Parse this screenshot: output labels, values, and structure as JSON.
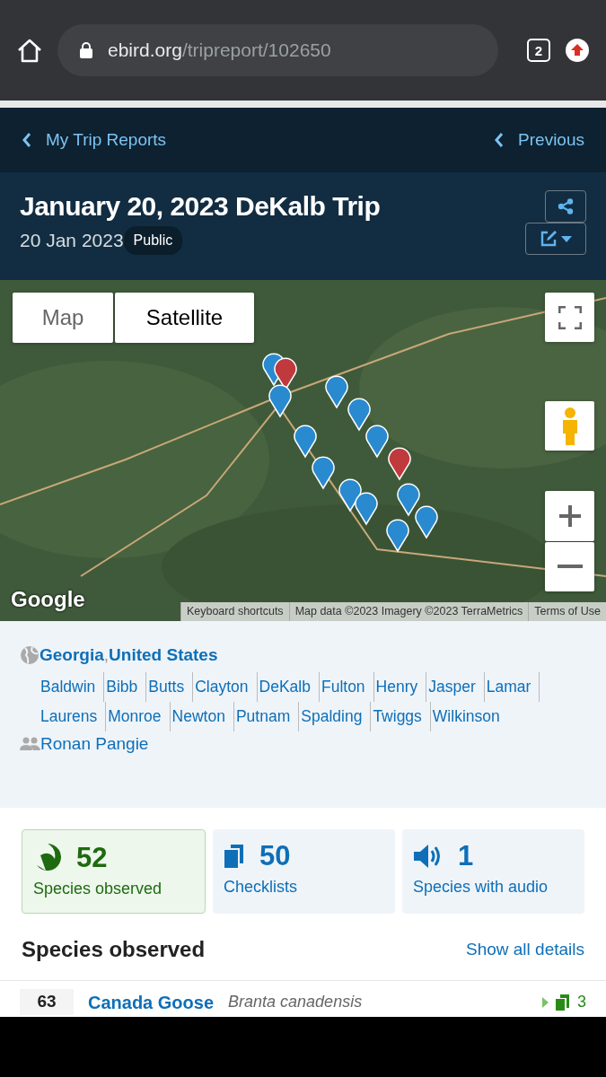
{
  "browser": {
    "url_host": "ebird.org",
    "url_path": "/tripreport/102650",
    "tab_count": "2"
  },
  "nav": {
    "back": "My Trip Reports",
    "previous": "Previous"
  },
  "header": {
    "title": "January 20, 2023 DeKalb Trip",
    "date": "20 Jan 2023",
    "visibility": "Public"
  },
  "map": {
    "type_buttons": [
      {
        "label": "Map",
        "selected": false
      },
      {
        "label": "Satellite",
        "selected": true
      }
    ],
    "logo": "Google",
    "attribution": [
      "Keyboard shortcuts",
      "Map data ©2023 Imagery ©2023 TerraMetrics",
      "Terms of Use"
    ]
  },
  "location": {
    "region": "Georgia",
    "separator": ",",
    "country": "United States",
    "counties": [
      "Baldwin",
      "Bibb",
      "Butts",
      "Clayton",
      "DeKalb",
      "Fulton",
      "Henry",
      "Jasper",
      "Lamar",
      "Laurens",
      "Monroe",
      "Newton",
      "Putnam",
      "Spalding",
      "Twiggs",
      "Wilkinson"
    ],
    "observer": "Ronan Pangie"
  },
  "stats": [
    {
      "kind": "species",
      "value": "52",
      "label": "Species observed",
      "selected": true
    },
    {
      "kind": "checklists",
      "value": "50",
      "label": "Checklists",
      "selected": false
    },
    {
      "kind": "audio",
      "value": "1",
      "label": "Species with audio",
      "selected": false
    }
  ],
  "species_section": {
    "title": "Species observed",
    "toggle": "Show all details",
    "rows": [
      {
        "count": "63",
        "common_name": "Canada Goose",
        "scientific_name": "Branta canadensis",
        "checklists": "3"
      }
    ]
  }
}
